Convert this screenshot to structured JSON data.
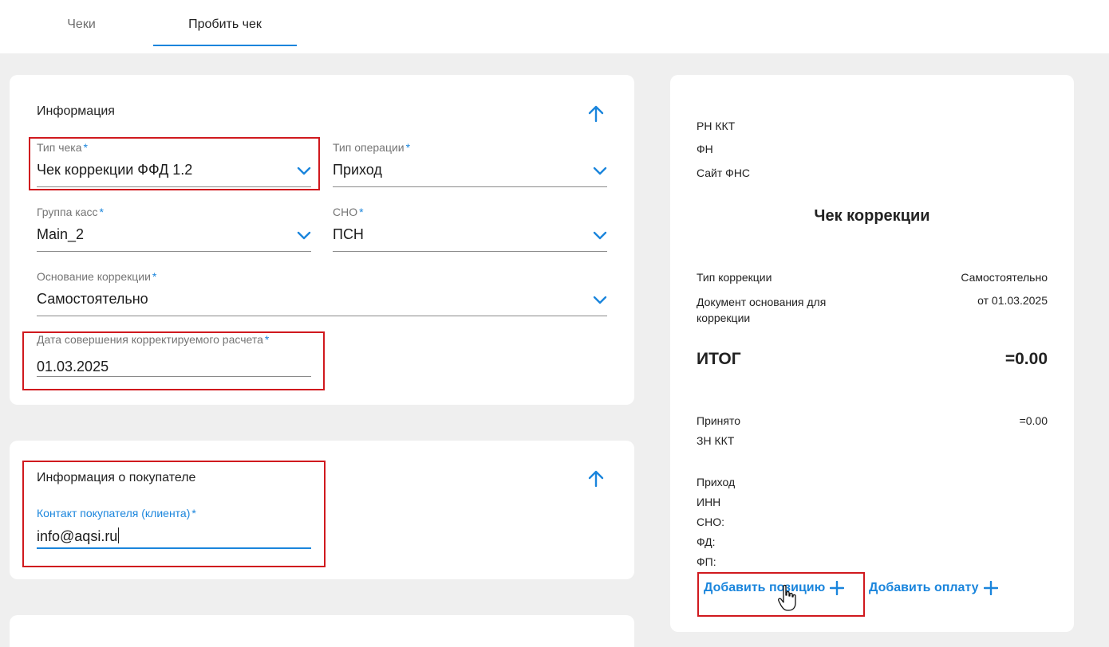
{
  "tabs": [
    {
      "label": "Чеки",
      "active": false
    },
    {
      "label": "Пробить чек",
      "active": true
    }
  ],
  "info": {
    "title": "Информация",
    "receipt_type": {
      "label": "Тип чека",
      "value": "Чек коррекции ФФД 1.2"
    },
    "operation_type": {
      "label": "Тип операции",
      "value": "Приход"
    },
    "cash_group": {
      "label": "Группа касс",
      "value": "Main_2"
    },
    "tax_system": {
      "label": "СНО",
      "value": "ПСН"
    },
    "correction_basis": {
      "label": "Основание коррекции",
      "value": "Самостоятельно"
    },
    "correction_date": {
      "label": "Дата совершения корректируемого расчета",
      "value": "01.03.2025"
    },
    "required_mark": "*"
  },
  "buyer": {
    "title": "Информация о покупателе",
    "contact": {
      "label": "Контакт покупателя (клиента)",
      "value": "info@aqsi.ru"
    }
  },
  "receipt": {
    "rn_kkt": "РН ККТ",
    "fn": "ФН",
    "fns_site": "Сайт ФНС",
    "title": "Чек коррекции",
    "correction_type_label": "Тип коррекции",
    "correction_type_value": "Самостоятельно",
    "basis_doc_label": "Документ основания для коррекции",
    "basis_doc_value": "от 01.03.2025",
    "total_label": "ИТОГ",
    "total_value": "=0.00",
    "accepted_label": "Принято",
    "accepted_value": "=0.00",
    "zn_kkt": "ЗН ККТ",
    "income": "Приход",
    "inn": "ИНН",
    "sno": "СНО:",
    "fd": "ФД:",
    "fp": "ФП:",
    "add_position": "Добавить позицию",
    "add_payment": "Добавить оплату"
  },
  "colors": {
    "accent": "#1a85dc",
    "highlight": "#d0191e",
    "background": "#efefef"
  },
  "icons": {
    "collapse": "arrow-up-icon",
    "dropdown": "chevron-down-icon",
    "add": "plus-icon",
    "cursor": "hand-pointer-icon"
  }
}
